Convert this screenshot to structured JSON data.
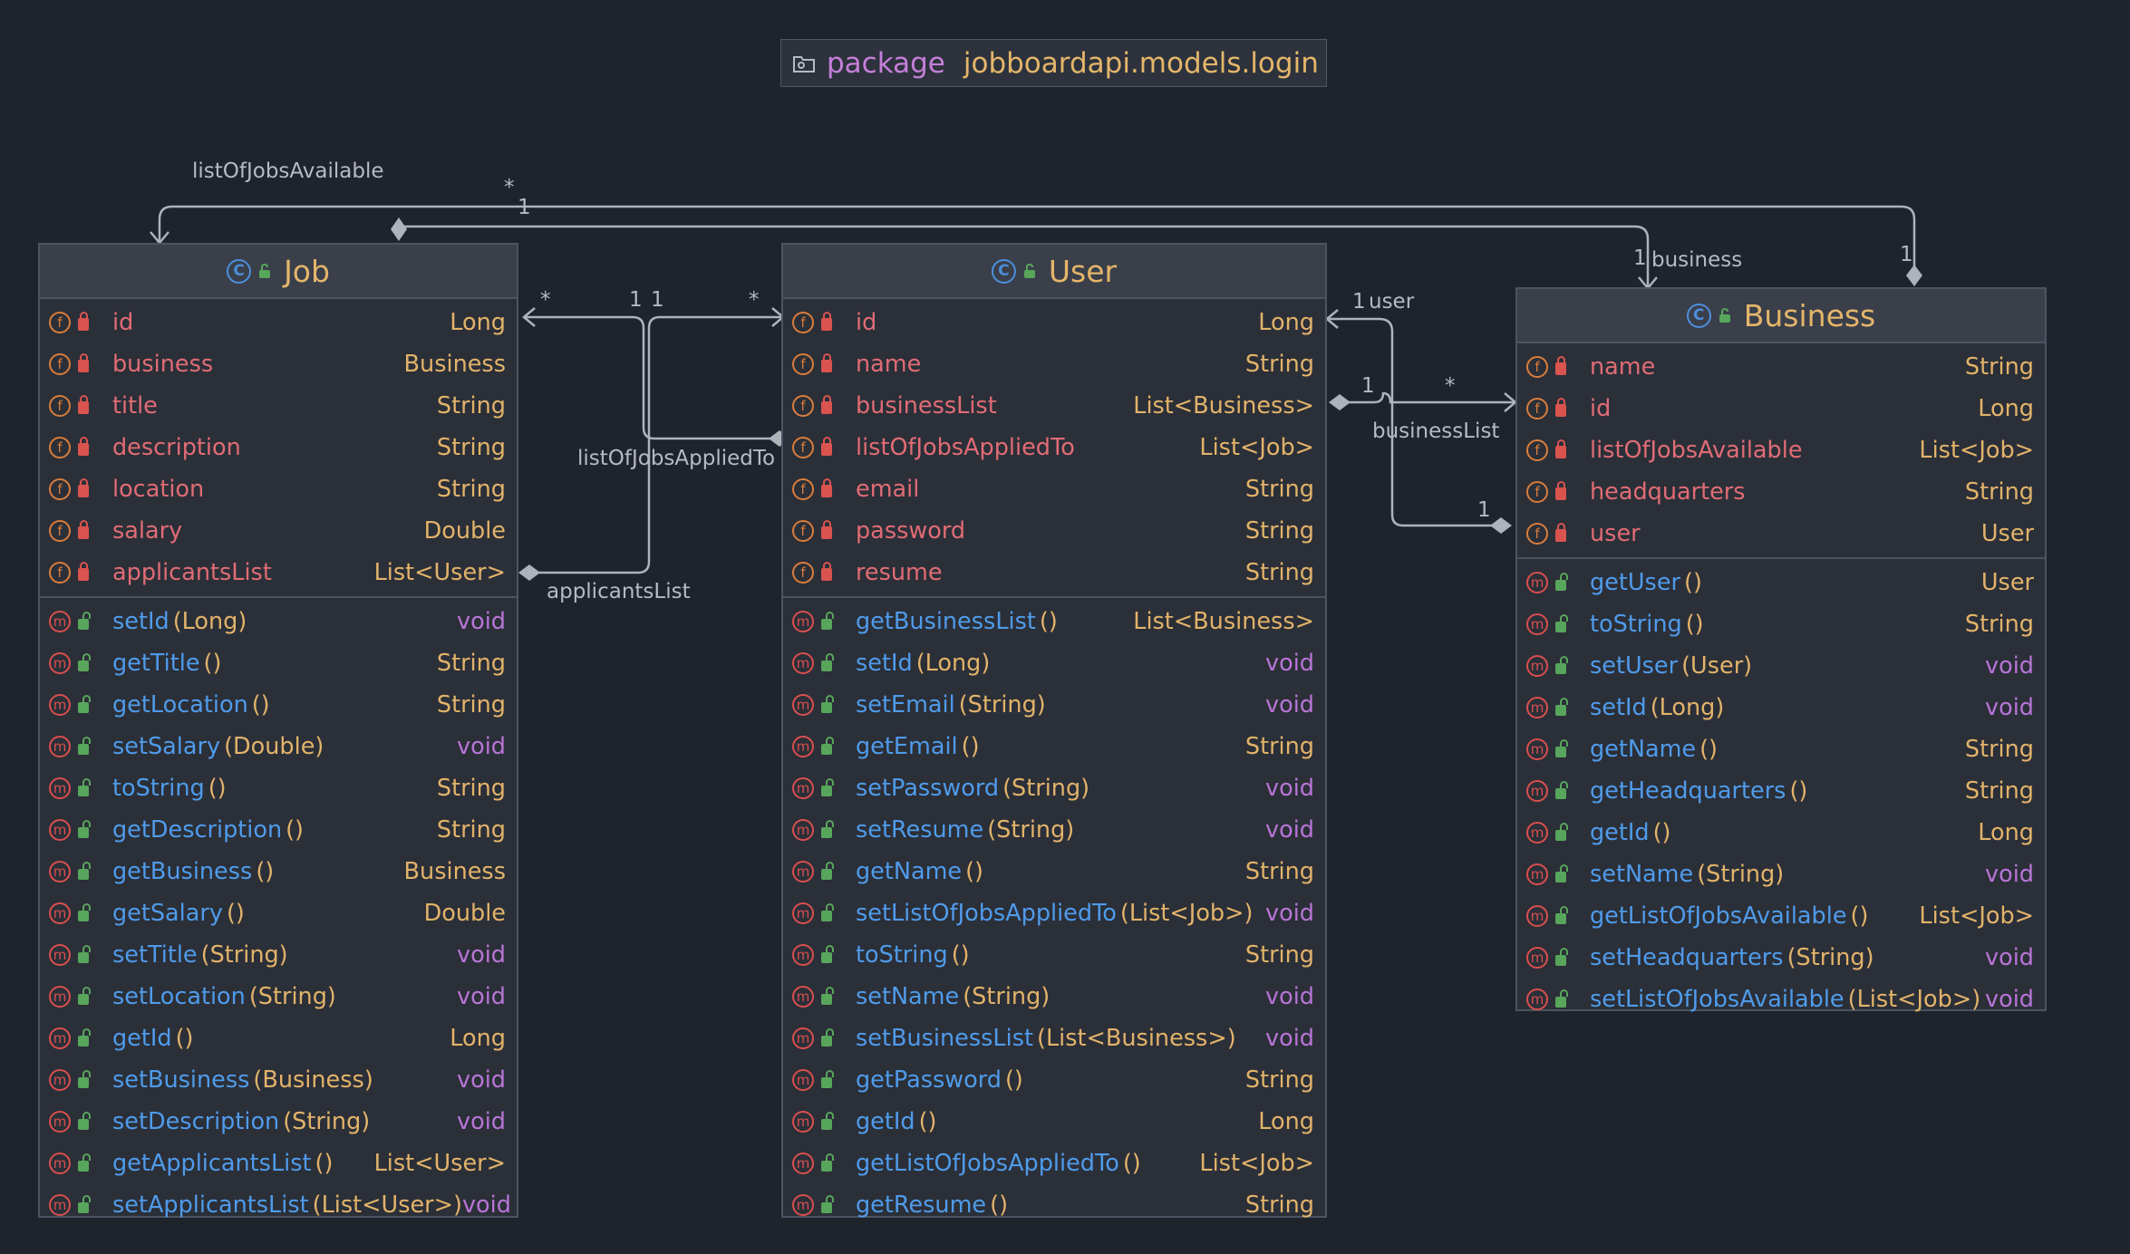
{
  "package": {
    "keyword": "package",
    "name": "jobboardapi.models.login",
    "icon": "folder-icon"
  },
  "colors": {
    "background": "#1f232b",
    "field": "#e06c75",
    "method": "#4f9bea",
    "type": "#e2b36a",
    "void": "#b775d6",
    "classname": "#e4b66a"
  },
  "classes": {
    "job": {
      "name": "Job",
      "fields": [
        {
          "name": "id",
          "type": "Long"
        },
        {
          "name": "business",
          "type": "Business"
        },
        {
          "name": "title",
          "type": "String"
        },
        {
          "name": "description",
          "type": "String"
        },
        {
          "name": "location",
          "type": "String"
        },
        {
          "name": "salary",
          "type": "Double"
        },
        {
          "name": "applicantsList",
          "type": "List<User>"
        }
      ],
      "methods": [
        {
          "name": "setId",
          "params": "(Long)",
          "type": "void"
        },
        {
          "name": "getTitle",
          "params": "()",
          "type": "String"
        },
        {
          "name": "getLocation",
          "params": "()",
          "type": "String"
        },
        {
          "name": "setSalary",
          "params": "(Double)",
          "type": "void"
        },
        {
          "name": "toString",
          "params": "()",
          "type": "String"
        },
        {
          "name": "getDescription",
          "params": "()",
          "type": "String"
        },
        {
          "name": "getBusiness",
          "params": "()",
          "type": "Business"
        },
        {
          "name": "getSalary",
          "params": "()",
          "type": "Double"
        },
        {
          "name": "setTitle",
          "params": "(String)",
          "type": "void"
        },
        {
          "name": "setLocation",
          "params": "(String)",
          "type": "void"
        },
        {
          "name": "getId",
          "params": "()",
          "type": "Long"
        },
        {
          "name": "setBusiness",
          "params": "(Business)",
          "type": "void"
        },
        {
          "name": "setDescription",
          "params": "(String)",
          "type": "void"
        },
        {
          "name": "getApplicantsList",
          "params": "()",
          "type": "List<User>"
        },
        {
          "name": "setApplicantsList",
          "params": "(List<User>)",
          "type": "void"
        }
      ]
    },
    "user": {
      "name": "User",
      "fields": [
        {
          "name": "id",
          "type": "Long"
        },
        {
          "name": "name",
          "type": "String"
        },
        {
          "name": "businessList",
          "type": "List<Business>"
        },
        {
          "name": "listOfJobsAppliedTo",
          "type": "List<Job>"
        },
        {
          "name": "email",
          "type": "String"
        },
        {
          "name": "password",
          "type": "String"
        },
        {
          "name": "resume",
          "type": "String"
        }
      ],
      "methods": [
        {
          "name": "getBusinessList",
          "params": "()",
          "type": "List<Business>"
        },
        {
          "name": "setId",
          "params": "(Long)",
          "type": "void"
        },
        {
          "name": "setEmail",
          "params": "(String)",
          "type": "void"
        },
        {
          "name": "getEmail",
          "params": "()",
          "type": "String"
        },
        {
          "name": "setPassword",
          "params": "(String)",
          "type": "void"
        },
        {
          "name": "setResume",
          "params": "(String)",
          "type": "void"
        },
        {
          "name": "getName",
          "params": "()",
          "type": "String"
        },
        {
          "name": "setListOfJobsAppliedTo",
          "params": "(List<Job>)",
          "type": "void"
        },
        {
          "name": "toString",
          "params": "()",
          "type": "String"
        },
        {
          "name": "setName",
          "params": "(String)",
          "type": "void"
        },
        {
          "name": "setBusinessList",
          "params": "(List<Business>)",
          "type": "void"
        },
        {
          "name": "getPassword",
          "params": "()",
          "type": "String"
        },
        {
          "name": "getId",
          "params": "()",
          "type": "Long"
        },
        {
          "name": "getListOfJobsAppliedTo",
          "params": "()",
          "type": "List<Job>"
        },
        {
          "name": "getResume",
          "params": "()",
          "type": "String"
        }
      ]
    },
    "business": {
      "name": "Business",
      "fields": [
        {
          "name": "name",
          "type": "String"
        },
        {
          "name": "id",
          "type": "Long"
        },
        {
          "name": "listOfJobsAvailable",
          "type": "List<Job>"
        },
        {
          "name": "headquarters",
          "type": "String"
        },
        {
          "name": "user",
          "type": "User"
        }
      ],
      "methods": [
        {
          "name": "getUser",
          "params": "()",
          "type": "User"
        },
        {
          "name": "toString",
          "params": "()",
          "type": "String"
        },
        {
          "name": "setUser",
          "params": "(User)",
          "type": "void"
        },
        {
          "name": "setId",
          "params": "(Long)",
          "type": "void"
        },
        {
          "name": "getName",
          "params": "()",
          "type": "String"
        },
        {
          "name": "getHeadquarters",
          "params": "()",
          "type": "String"
        },
        {
          "name": "getId",
          "params": "()",
          "type": "Long"
        },
        {
          "name": "setName",
          "params": "(String)",
          "type": "void"
        },
        {
          "name": "getListOfJobsAvailable",
          "params": "()",
          "type": "List<Job>"
        },
        {
          "name": "setHeadquarters",
          "params": "(String)",
          "type": "void"
        },
        {
          "name": "setListOfJobsAvailable",
          "params": "(List<Job>)",
          "type": "void"
        }
      ]
    }
  },
  "links": {
    "listOfJobsAvailable": "listOfJobsAvailable",
    "listOfJobsAppliedTo": "listOfJobsAppliedTo",
    "applicantsList": "applicantsList",
    "businessList": "businessList",
    "business": "business",
    "user": "user",
    "one": "1",
    "many": "*"
  }
}
